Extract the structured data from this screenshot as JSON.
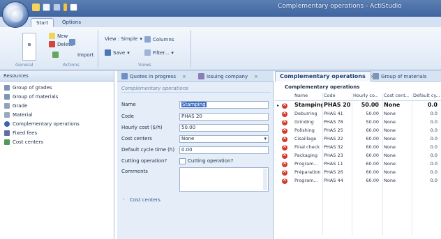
{
  "window": {
    "title": "Complementary operations - ActiStudio"
  },
  "ribbon": {
    "tabs": [
      "Start",
      "Options"
    ],
    "buttons": {
      "new": "New",
      "delete": "Delete",
      "import": "Import",
      "view": "View : Simple",
      "columns": "Columns",
      "save": "Save",
      "filter": "Filter..."
    },
    "groups": {
      "general": "General",
      "actions": "Actions",
      "views": "Views"
    }
  },
  "resources": {
    "header": "Resources",
    "items": [
      {
        "label": "Group of grades",
        "icon": "group-icon"
      },
      {
        "label": "Group of materials",
        "icon": "group-icon"
      },
      {
        "label": "Grade",
        "icon": "grade-icon"
      },
      {
        "label": "Material",
        "icon": "material-icon"
      },
      {
        "label": "Complementary operations",
        "icon": "operations-icon"
      },
      {
        "label": "Fixed fees",
        "icon": "fees-icon"
      },
      {
        "label": "Cost centers",
        "icon": "cost-centers-icon"
      }
    ]
  },
  "middle": {
    "tabs": [
      {
        "label": "Quotes in progress"
      },
      {
        "label": "Issuing company"
      }
    ],
    "section_title": "Complementary operations",
    "fields": {
      "name_label": "Name",
      "name_value": "Stamping",
      "code_label": "Code",
      "code_value": "PHAS 20",
      "hourly_label": "Hourly cost ($/h)",
      "hourly_value": "50.00",
      "cost_centers_label": "Cost centers",
      "cost_centers_value": "None",
      "cycle_label": "Default cycle time (h)",
      "cycle_value": "0.00",
      "cutting_label": "Cutting operation?",
      "cutting_checkbox_label": "Cutting operation?",
      "comments_label": "Comments"
    },
    "cost_centers_section": "Cost centers"
  },
  "grid": {
    "tabs": [
      {
        "label": "Complementary operations"
      },
      {
        "label": "Group of materials"
      }
    ],
    "title": "Complementary operations",
    "columns": [
      "Name",
      "Code",
      "Hourly co...",
      "Cost cent...",
      "Default cy..."
    ],
    "rows": [
      {
        "name": "Stamping",
        "code": "PHAS 20",
        "hourly": "50.00",
        "cost": "None",
        "cycle": "0.0",
        "selected": true
      },
      {
        "name": "Deburring",
        "code": "PHAS 41",
        "hourly": "50.00",
        "cost": "None",
        "cycle": "0.0"
      },
      {
        "name": "Grinding",
        "code": "PHAS 78",
        "hourly": "50.00",
        "cost": "None",
        "cycle": "0.0"
      },
      {
        "name": "Polishing",
        "code": "PHAS 25",
        "hourly": "60.00",
        "cost": "None",
        "cycle": "0.0"
      },
      {
        "name": "Cisaillage",
        "code": "PHAS 22",
        "hourly": "60.00",
        "cost": "None",
        "cycle": "0.0"
      },
      {
        "name": "Final check",
        "code": "PHAS 32",
        "hourly": "60.00",
        "cost": "None",
        "cycle": "0.0"
      },
      {
        "name": "Packaging",
        "code": "PHAS 23",
        "hourly": "60.00",
        "cost": "None",
        "cycle": "0.0"
      },
      {
        "name": "Program...",
        "code": "PHAS 11",
        "hourly": "60.00",
        "cost": "None",
        "cycle": "0.0"
      },
      {
        "name": "Préparation",
        "code": "PHAS 26",
        "hourly": "60.00",
        "cost": "None",
        "cycle": "0.0"
      },
      {
        "name": "Program...",
        "code": "PHAS 44",
        "hourly": "60.00",
        "cost": "None",
        "cycle": "0.0"
      }
    ]
  }
}
